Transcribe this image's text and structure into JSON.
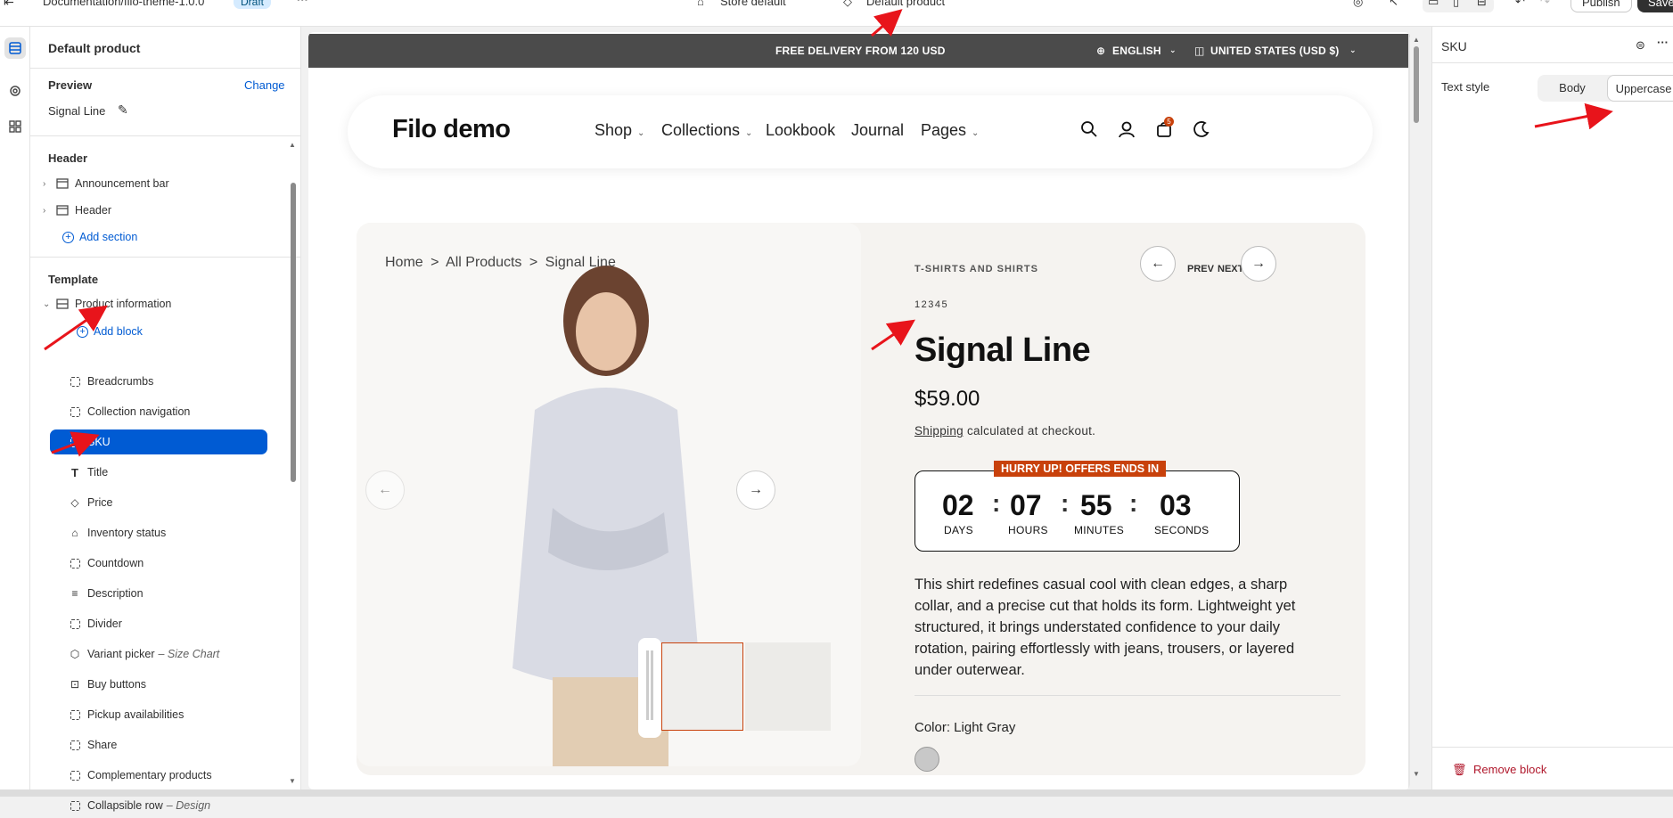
{
  "topbar": {
    "breadcrumb": "Documentation/filo-theme-1.0.0",
    "status_badge": "Draft",
    "more_label": "···",
    "store_selector": "Store default",
    "template_selector": "Default product",
    "publish_label": "Publish",
    "save_label": "Save"
  },
  "sidebar": {
    "product_title": "Default product",
    "preview_label": "Preview",
    "change_link": "Change",
    "preview_product": "Signal Line",
    "header_section": "Header",
    "header_items": [
      "Announcement bar",
      "Header"
    ],
    "add_section": "Add section",
    "template_section": "Template",
    "product_information": "Product information",
    "add_block": "Add block",
    "blocks": [
      {
        "label": "Breadcrumbs",
        "icon": "dashed-block-icon"
      },
      {
        "label": "Collection navigation",
        "icon": "dashed-block-icon"
      },
      {
        "label": "SKU",
        "icon": "dashed-block-icon"
      },
      {
        "label": "Title",
        "icon": "text-icon"
      },
      {
        "label": "Price",
        "icon": "price-tag-icon"
      },
      {
        "label": "Inventory status",
        "icon": "inventory-icon"
      },
      {
        "label": "Countdown",
        "icon": "dashed-block-icon"
      },
      {
        "label": "Description",
        "icon": "text-lines-icon"
      },
      {
        "label": "Divider",
        "icon": "dashed-block-icon"
      },
      {
        "label": "Variant picker",
        "icon": "variant-icon",
        "suffix": "– Size Chart"
      },
      {
        "label": "Buy buttons",
        "icon": "cart-button-icon"
      },
      {
        "label": "Pickup availabilities",
        "icon": "dashed-block-icon"
      },
      {
        "label": "Share",
        "icon": "dashed-block-icon"
      },
      {
        "label": "Complementary products",
        "icon": "dashed-block-icon"
      },
      {
        "label": "Collapsible row",
        "icon": "dashed-block-icon",
        "suffix": "– Design"
      }
    ]
  },
  "storefront": {
    "announcement": "FREE DELIVERY FROM 120 USD",
    "language": "ENGLISH",
    "country": "UNITED STATES (USD $)",
    "logo": "Filo demo",
    "menu": [
      "Shop",
      "Collections",
      "Lookbook",
      "Journal",
      "Pages"
    ],
    "cart_count": "5",
    "breadcrumb": [
      "Home",
      ">",
      "All Products",
      ">",
      "Signal Line"
    ],
    "product": {
      "category": "T-SHIRTS AND SHIRTS",
      "prev": "PREV",
      "next": "NEXT",
      "sku": "12345",
      "title": "Signal Line",
      "price": "$59.00",
      "shipping_link": "Shipping",
      "shipping_text": " calculated at checkout.",
      "countdown_banner": "HURRY UP! OFFERS ENDS IN",
      "countdown": [
        {
          "value": "02",
          "label": "DAYS"
        },
        {
          "value": "07",
          "label": "HOURS"
        },
        {
          "value": "55",
          "label": "MINUTES"
        },
        {
          "value": "03",
          "label": "SECONDS"
        }
      ],
      "description": "This shirt redefines casual cool with clean edges, a sharp collar, and a precise cut that holds its form. Lightweight yet structured, it brings understated confidence to your daily rotation, pairing effortlessly with jeans, trousers, or layered under outerwear.",
      "color_label": "Color: Light Gray"
    }
  },
  "settings_panel": {
    "title": "SKU",
    "text_style_label": "Text style",
    "options": [
      "Body",
      "Uppercase"
    ],
    "selected_option": "Uppercase",
    "remove_block": "Remove block"
  },
  "colors": {
    "accent": "#005bd3",
    "annotation_arrow": "#e8141b",
    "countdown_banner": "#c8410b",
    "remove": "#b0172b"
  }
}
